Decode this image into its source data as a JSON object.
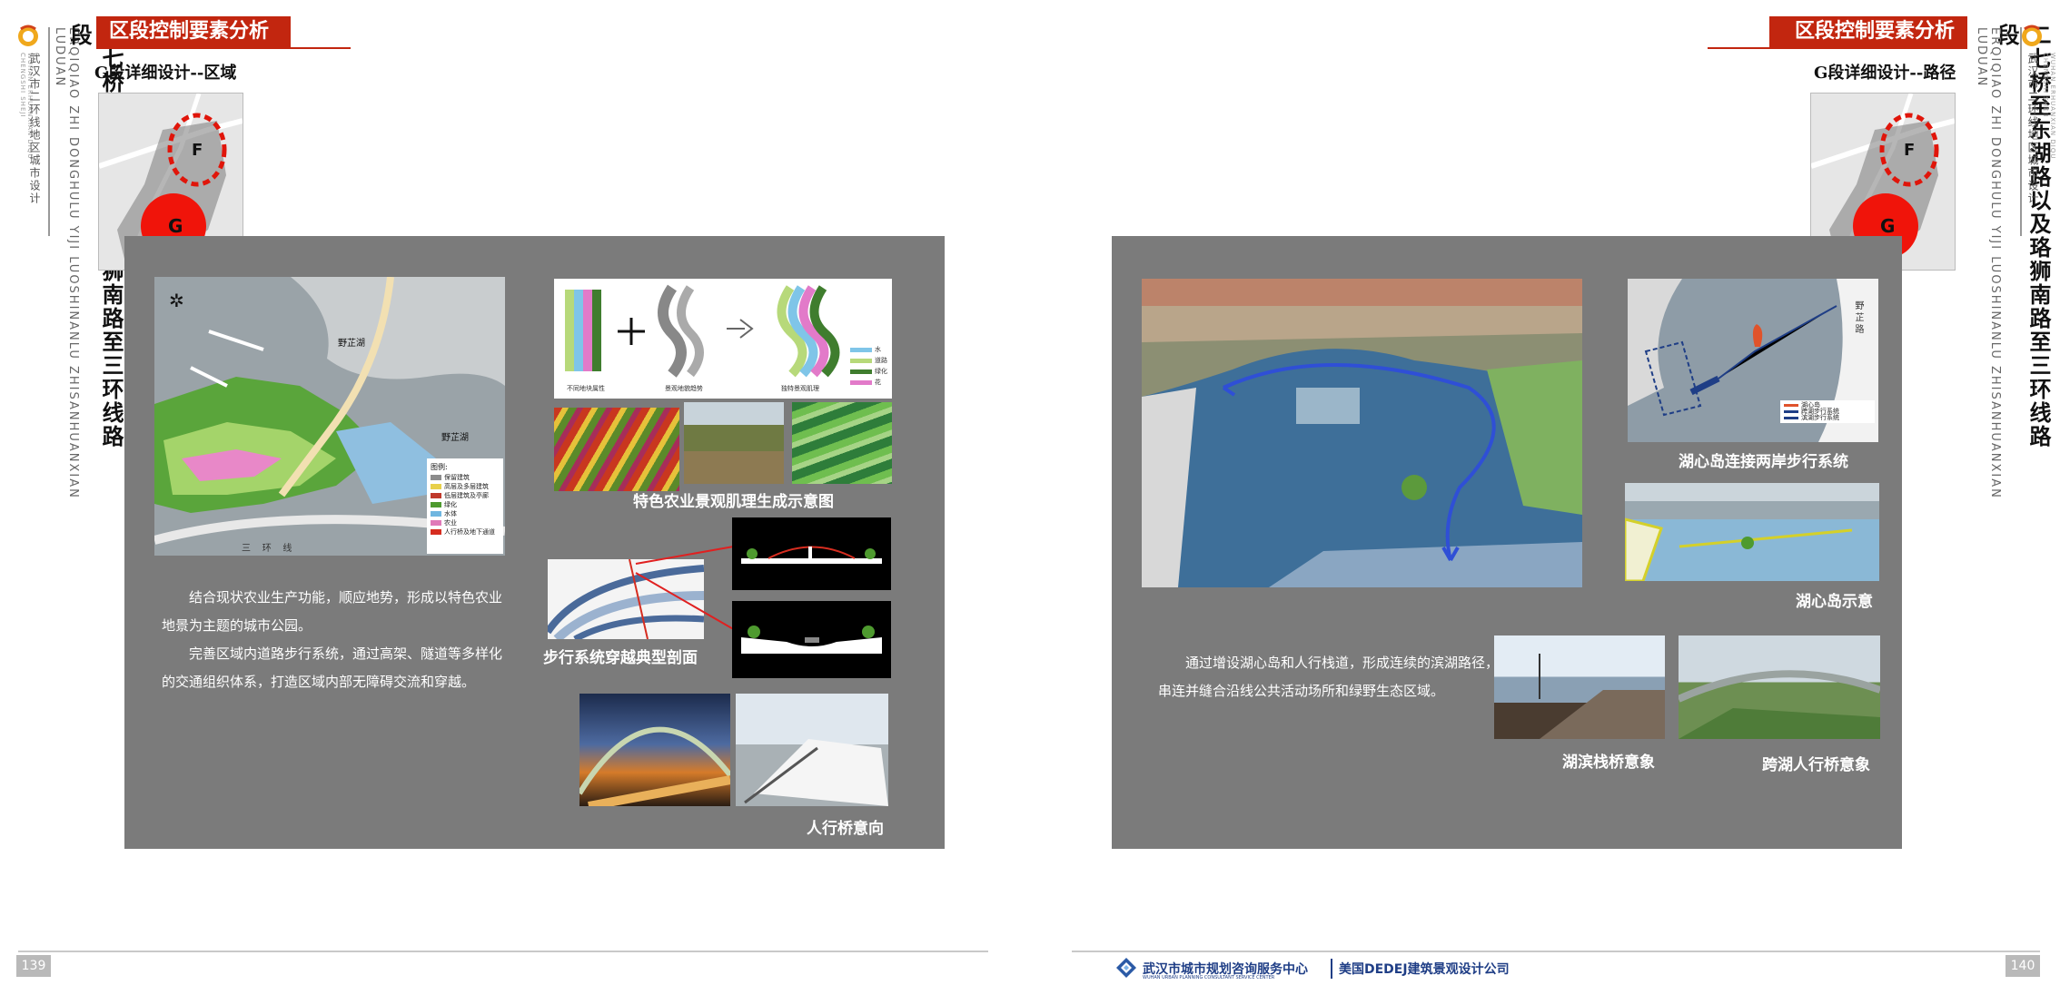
{
  "left": {
    "header_tab": "区段控制要素分析",
    "subtitle": "G段详细设计--区域",
    "vertical_title": "二七桥至东湖路以及珞狮南路至三环线路段",
    "vertical_pinyin": "ERQIQIAO ZHI DONGHULU YIJI LUOSHINANLU ZHISANHUANXIAN LUDUAN",
    "vertical_org": "武汉市二环线地区城市设计",
    "vertical_org_en": "WUHAN ERHUANXIAN DIQU CHENGSHI SHEJI",
    "keymap": {
      "f": "F",
      "g": "G"
    },
    "map": {
      "lake1": "野芷湖",
      "lake2": "野芷湖",
      "road": "三    环    线",
      "legend_title": "图例:",
      "legend": [
        {
          "label": "保留建筑",
          "color": "#8c8c8c"
        },
        {
          "label": "高层及多层建筑",
          "color": "#e8d04a"
        },
        {
          "label": "低层建筑及亭廊",
          "color": "#c0392b"
        },
        {
          "label": "绿化",
          "color": "#4e9a2f"
        },
        {
          "label": "水体",
          "color": "#6fb6e0"
        },
        {
          "label": "农业",
          "color": "#e07ab8"
        },
        {
          "label": "人行桥及地下通道",
          "color": "#d62d20"
        }
      ]
    },
    "texture_diagram": {
      "labels": [
        "不同地块属性",
        "景观地貌趋势",
        "独特景观肌理"
      ],
      "legend": [
        "水",
        "道路",
        "绿化",
        "花"
      ],
      "legend_colors": [
        "#7fc5e8",
        "#b7d97a",
        "#3f7d2e",
        "#e27ac9"
      ]
    },
    "caption_texture": "特色农业景观肌理生成示意图",
    "caption_section": "步行系统穿越典型剖面",
    "caption_bridge": "人行桥意向",
    "paragraph1": "结合现状农业生产功能，顺应地势，形成以特色农业地景为主题的城市公园。",
    "paragraph2": "完善区域内道路步行系统，通过高架、隧道等多样化的交通组织体系，打造区域内部无障碍交流和穿越。",
    "page_number": "139"
  },
  "right": {
    "header_tab": "区段控制要素分析",
    "subtitle": "G段详细设计--路径",
    "vertical_title": "二七桥至东湖路以及珞狮南路至三环线路段",
    "vertical_pinyin": "ERQIQIAO ZHI DONGHULU YIJI LUOSHINANLU ZHISANHUANXIAN LUDUAN",
    "vertical_org": "武汉市二环线地区城市设计",
    "vertical_org_en": "WUHAN ERHUANXIAN DIQU CHENGSHI SHEJI",
    "keymap": {
      "f": "F",
      "g": "G"
    },
    "island_map": {
      "road": "野 芷 路",
      "legend": [
        {
          "label": "湖心岛",
          "color": "#e0532b"
        },
        {
          "label": "跨湖步行系统",
          "color": "#1f3e86"
        },
        {
          "label": "滨湖步行系统",
          "color": "#1f3e86"
        }
      ]
    },
    "caption_island_system": "湖心岛连接两岸步行系统",
    "caption_island": "湖心岛示意",
    "caption_boardwalk": "湖滨栈桥意象",
    "caption_lake_bridge": "跨湖人行桥意象",
    "paragraph": "通过增设湖心岛和人行栈道，形成连续的滨湖路径，串连并缝合沿线公共活动场所和绿野生态区域。",
    "page_number": "140",
    "footer_org1": "武汉市城市规划咨询服务中心",
    "footer_org1_en": "WUHAN URBAN PLANNING CONSULTANT SERVICE CENTER",
    "footer_org2": "美国DEDEJ建筑景观设计公司"
  }
}
